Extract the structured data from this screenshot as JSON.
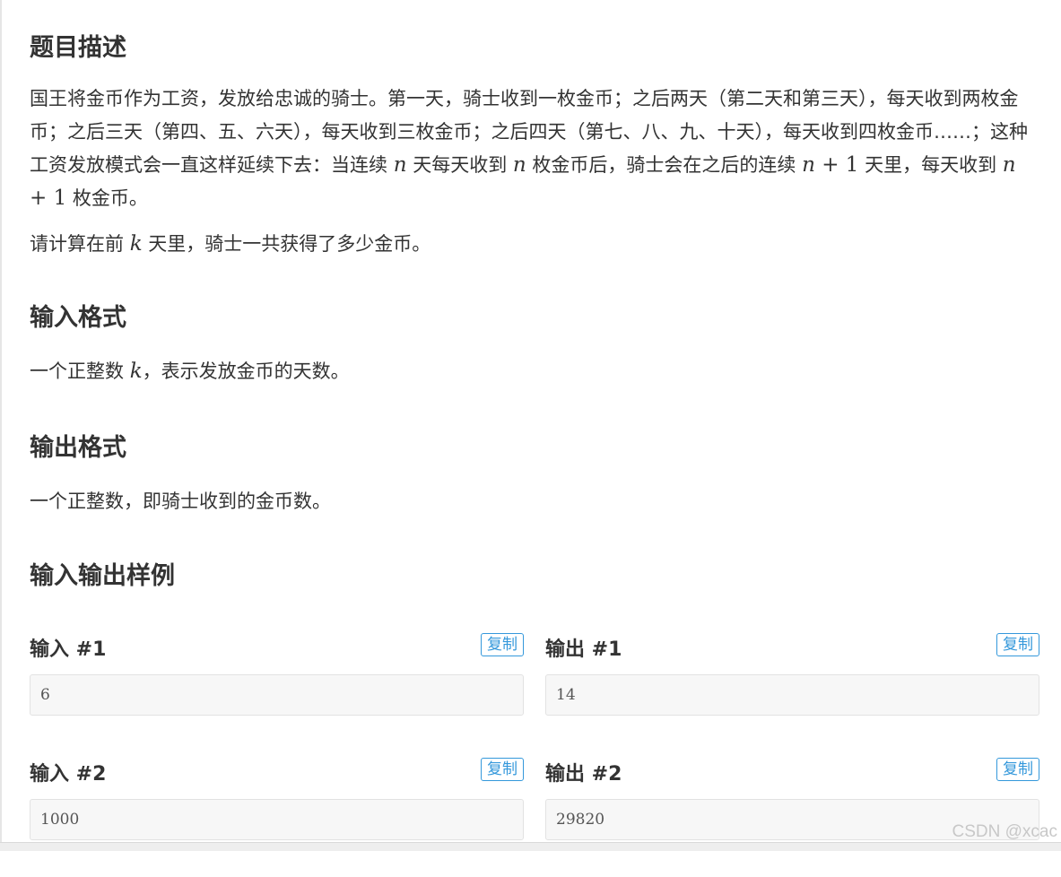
{
  "description": {
    "title": "题目描述",
    "para1": {
      "t1": "国王将金币作为工资，发放给忠诚的骑士。第一天，骑士收到一枚金币；之后两天（第二天和第三天），每天收到两枚金币；之后三天（第四、五、六天），每天收到三枚金币；之后四天（第七、八、九、十天），每天收到四枚金币……；这种工资发放模式会一直这样延续下去：当连续 ",
      "m1": "n",
      "t2": " 天每天收到 ",
      "m2": "n",
      "t3": " 枚金币后，骑士会在之后的连续 ",
      "m3a": "n",
      "m3b": " + 1",
      "t4": " 天里，每天收到 ",
      "m4a": "n",
      "m4b": " + 1",
      "t5": " 枚金币。"
    },
    "para2": {
      "t1": "请计算在前 ",
      "m1": "k",
      "t2": " 天里，骑士一共获得了多少金币。"
    }
  },
  "input_format": {
    "title": "输入格式",
    "t1": "一个正整数 ",
    "m1": "k",
    "t2": "，表示发放金币的天数。"
  },
  "output_format": {
    "title": "输出格式",
    "text": "一个正整数，即骑士收到的金币数。"
  },
  "samples": {
    "title": "输入输出样例",
    "copy_label": "复制",
    "items": [
      {
        "input_label": "输入 #1",
        "input": "6",
        "output_label": "输出 #1",
        "output": "14"
      },
      {
        "input_label": "输入 #2",
        "input": "1000",
        "output_label": "输出 #2",
        "output": "29820"
      }
    ]
  },
  "watermark": "CSDN @xcac"
}
